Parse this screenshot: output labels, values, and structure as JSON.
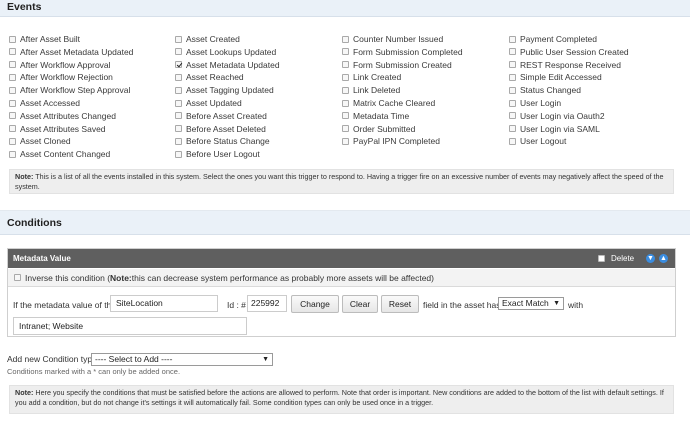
{
  "events": {
    "title": "Events",
    "columns": [
      [
        {
          "label": "After Asset Built",
          "checked": false
        },
        {
          "label": "After Asset Metadata Updated",
          "checked": false
        },
        {
          "label": "After Workflow Approval",
          "checked": false
        },
        {
          "label": "After Workflow Rejection",
          "checked": false
        },
        {
          "label": "After Workflow Step Approval",
          "checked": false
        },
        {
          "label": "Asset Accessed",
          "checked": false
        },
        {
          "label": "Asset Attributes Changed",
          "checked": false
        },
        {
          "label": "Asset Attributes Saved",
          "checked": false
        },
        {
          "label": "Asset Cloned",
          "checked": false
        },
        {
          "label": "Asset Content Changed",
          "checked": false
        }
      ],
      [
        {
          "label": "Asset Created",
          "checked": false
        },
        {
          "label": "Asset Lookups Updated",
          "checked": false
        },
        {
          "label": "Asset Metadata Updated",
          "checked": true
        },
        {
          "label": "Asset Reached",
          "checked": false
        },
        {
          "label": "Asset Tagging Updated",
          "checked": false
        },
        {
          "label": "Asset Updated",
          "checked": false
        },
        {
          "label": "Before Asset Created",
          "checked": false
        },
        {
          "label": "Before Asset Deleted",
          "checked": false
        },
        {
          "label": "Before Status Change",
          "checked": false
        },
        {
          "label": "Before User Logout",
          "checked": false
        }
      ],
      [
        {
          "label": "Counter Number Issued",
          "checked": false
        },
        {
          "label": "Form Submission Completed",
          "checked": false
        },
        {
          "label": "Form Submission Created",
          "checked": false
        },
        {
          "label": "Link Created",
          "checked": false
        },
        {
          "label": "Link Deleted",
          "checked": false
        },
        {
          "label": "Matrix Cache Cleared",
          "checked": false
        },
        {
          "label": "Metadata Time",
          "checked": false
        },
        {
          "label": "Order Submitted",
          "checked": false
        },
        {
          "label": "PayPal IPN Completed",
          "checked": false
        }
      ],
      [
        {
          "label": "Payment Completed",
          "checked": false
        },
        {
          "label": "Public User Session Created",
          "checked": false
        },
        {
          "label": "REST Response Received",
          "checked": false
        },
        {
          "label": "Simple Edit Accessed",
          "checked": false
        },
        {
          "label": "Status Changed",
          "checked": false
        },
        {
          "label": "User Login",
          "checked": false
        },
        {
          "label": "User Login via Oauth2",
          "checked": false
        },
        {
          "label": "User Login via SAML",
          "checked": false
        },
        {
          "label": "User Logout",
          "checked": false
        }
      ]
    ],
    "note_label": "Note:",
    "note_text": " This is a list of all the events installed in this system. Select the ones you want this trigger to respond to. Having a trigger fire on an excessive number of events may negatively affect the speed of the system."
  },
  "conditions": {
    "title": "Conditions",
    "metadata_panel": {
      "title": "Metadata Value",
      "delete_label": "Delete",
      "move_down_icon": "arrow-down-icon",
      "move_up_icon": "arrow-up-icon",
      "accent_color": "#3b8de0",
      "inverse_text": "Inverse this condition (",
      "inverse_note_label": "Note:",
      "inverse_note_text": " this can decrease system performance as probably more assets will be affected)",
      "prefix_text": "If the metadata value of the",
      "field_name": "SiteLocation",
      "id_label": "Id : #",
      "id_value": "225992",
      "change_button": "Change",
      "clear_button": "Clear",
      "reset_button": "Reset",
      "middle_text": "field in the asset has a",
      "match_select": "Exact Match",
      "with_text": "with",
      "value": "Intranet; Website"
    },
    "add_label": "Add new Condition type:",
    "add_select": "---- Select to Add  ----",
    "hint": "Conditions marked with a * can only be added once.",
    "note_label": "Note:",
    "note_text": " Here you specify the conditions that must be satisfied before the actions are allowed to perform. Note that order is important. New conditions are added to the bottom of the list with default settings. If you add a condition, but do not change it's settings it will automatically fail. Some condition types can only be used once in a trigger."
  }
}
